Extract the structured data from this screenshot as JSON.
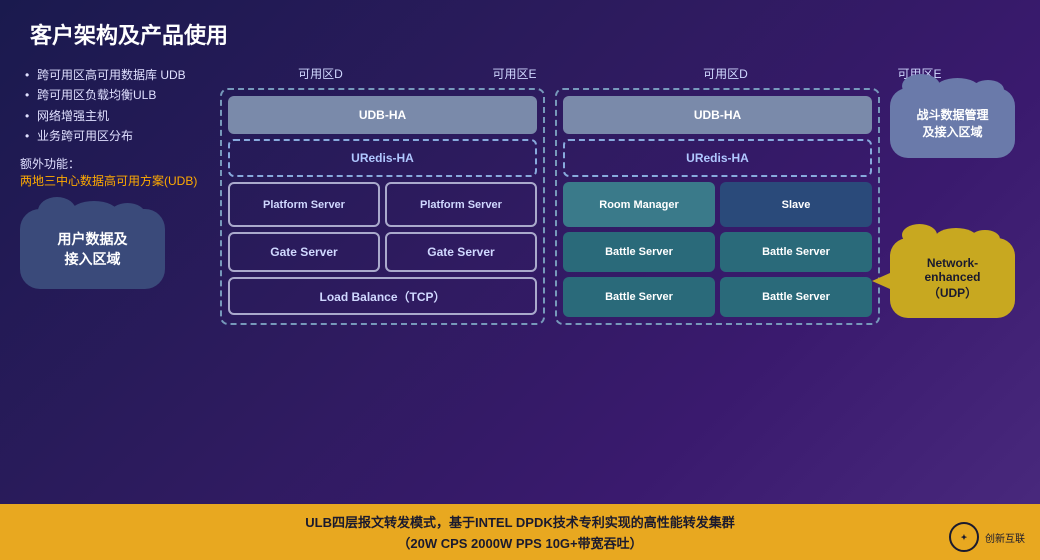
{
  "title": "客户架构及产品使用",
  "bullets": [
    "跨可用区高可用数据库 UDB",
    "跨可用区负载均衡ULB",
    "网络增强主机",
    "业务跨可用区分布"
  ],
  "extra_title": "额外功能：",
  "extra_link": "两地三中心数据高可用方案(UDB)",
  "cloud_left_label": "用户数据及\n接入区域",
  "cloud_right_label": "战斗数据管理\n及接入区域",
  "cloud_network_label": "Network-\nenhanced\n（UDP）",
  "zone_d1": "可用区D",
  "zone_e1": "可用区E",
  "zone_d2": "可用区D",
  "zone_e2": "可用区E",
  "left_group": {
    "udb": "UDB-HA",
    "uredis": "URedis-HA",
    "platform1": "Platform\nServer",
    "platform2": "Platform\nServer",
    "gate1": "Gate\nServer",
    "gate2": "Gate\nServer",
    "load_balance": "Load Balance（TCP）"
  },
  "right_group": {
    "udb": "UDB-HA",
    "uredis": "URedis-HA",
    "room_manager": "Room\nManager",
    "slave": "Slave",
    "battle1": "Battle\nServer",
    "battle2": "Battle\nServer",
    "battle3": "Battle\nServer",
    "battle4": "Battle\nServer"
  },
  "bottom_line1": "ULB四层报文转发模式，基于INTEL  DPDK技术专利实现的高性能转发集群",
  "bottom_line2": "（20W CPS  2000W PPS  10G+带宽吞吐）",
  "logo_text": "创新互联"
}
